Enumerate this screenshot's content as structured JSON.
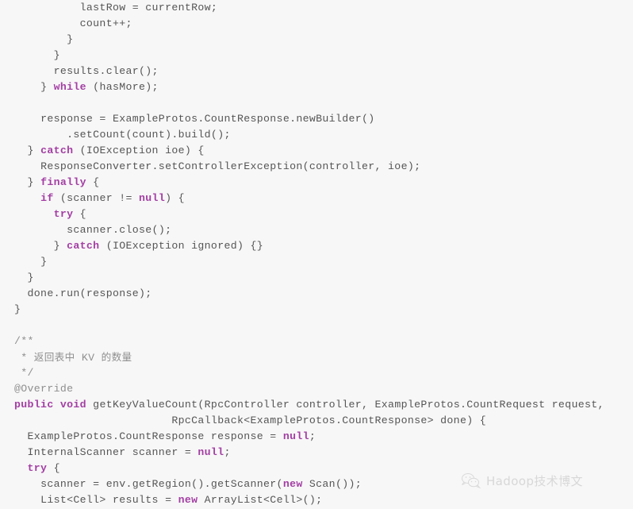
{
  "editor": {
    "language": "java",
    "background_color": "#f7f7f7",
    "default_text_color": "#555555",
    "keyword_color": "#a33ea3",
    "comment_color": "#8f8f8f",
    "lines": [
      {
        "indent": "          ",
        "segments": [
          {
            "t": "lastRow = currentRow;",
            "k": "plain"
          }
        ]
      },
      {
        "indent": "          ",
        "segments": [
          {
            "t": "count++;",
            "k": "plain"
          }
        ]
      },
      {
        "indent": "        ",
        "segments": [
          {
            "t": "}",
            "k": "plain"
          }
        ]
      },
      {
        "indent": "      ",
        "segments": [
          {
            "t": "}",
            "k": "plain"
          }
        ]
      },
      {
        "indent": "      ",
        "segments": [
          {
            "t": "results.clear();",
            "k": "plain"
          }
        ]
      },
      {
        "indent": "    ",
        "segments": [
          {
            "t": "} ",
            "k": "plain"
          },
          {
            "t": "while",
            "k": "kw"
          },
          {
            "t": " (hasMore);",
            "k": "plain"
          }
        ]
      },
      {
        "indent": "",
        "segments": []
      },
      {
        "indent": "    ",
        "segments": [
          {
            "t": "response = ExampleProtos.CountResponse.newBuilder()",
            "k": "plain"
          }
        ]
      },
      {
        "indent": "        ",
        "segments": [
          {
            "t": ".setCount(count).build();",
            "k": "plain"
          }
        ]
      },
      {
        "indent": "  ",
        "segments": [
          {
            "t": "} ",
            "k": "plain"
          },
          {
            "t": "catch",
            "k": "kw"
          },
          {
            "t": " (IOException ioe) {",
            "k": "plain"
          }
        ]
      },
      {
        "indent": "    ",
        "segments": [
          {
            "t": "ResponseConverter.setControllerException(controller, ioe);",
            "k": "plain"
          }
        ]
      },
      {
        "indent": "  ",
        "segments": [
          {
            "t": "} ",
            "k": "plain"
          },
          {
            "t": "finally",
            "k": "kw"
          },
          {
            "t": " {",
            "k": "plain"
          }
        ]
      },
      {
        "indent": "    ",
        "segments": [
          {
            "t": "if",
            "k": "kw"
          },
          {
            "t": " (scanner != ",
            "k": "plain"
          },
          {
            "t": "null",
            "k": "kw"
          },
          {
            "t": ") {",
            "k": "plain"
          }
        ]
      },
      {
        "indent": "      ",
        "segments": [
          {
            "t": "try",
            "k": "kw"
          },
          {
            "t": " {",
            "k": "plain"
          }
        ]
      },
      {
        "indent": "        ",
        "segments": [
          {
            "t": "scanner.close();",
            "k": "plain"
          }
        ]
      },
      {
        "indent": "      ",
        "segments": [
          {
            "t": "} ",
            "k": "plain"
          },
          {
            "t": "catch",
            "k": "kw"
          },
          {
            "t": " (IOException ignored) {}",
            "k": "plain"
          }
        ]
      },
      {
        "indent": "    ",
        "segments": [
          {
            "t": "}",
            "k": "plain"
          }
        ]
      },
      {
        "indent": "  ",
        "segments": [
          {
            "t": "}",
            "k": "plain"
          }
        ]
      },
      {
        "indent": "  ",
        "segments": [
          {
            "t": "done.run(response);",
            "k": "plain"
          }
        ]
      },
      {
        "indent": "",
        "segments": [
          {
            "t": "}",
            "k": "plain"
          }
        ]
      },
      {
        "indent": "",
        "segments": []
      },
      {
        "indent": "",
        "segments": [
          {
            "t": "/**",
            "k": "cmt"
          }
        ]
      },
      {
        "indent": "",
        "segments": [
          {
            "t": " * ",
            "k": "cmt"
          },
          {
            "t": "返回表中",
            "k": "cmt-cjk"
          },
          {
            "t": " KV ",
            "k": "cmt"
          },
          {
            "t": "的数量",
            "k": "cmt-cjk"
          }
        ]
      },
      {
        "indent": "",
        "segments": [
          {
            "t": " */",
            "k": "cmt"
          }
        ]
      },
      {
        "indent": "",
        "segments": [
          {
            "t": "@Override",
            "k": "cmt"
          }
        ]
      },
      {
        "indent": "",
        "segments": [
          {
            "t": "public",
            "k": "kw"
          },
          {
            "t": " ",
            "k": "plain"
          },
          {
            "t": "void",
            "k": "kw"
          },
          {
            "t": " getKeyValueCount(RpcController controller, ExampleProtos.CountRequest request,",
            "k": "plain"
          }
        ]
      },
      {
        "indent": "                        ",
        "segments": [
          {
            "t": "RpcCallback<ExampleProtos.CountResponse> done) {",
            "k": "plain"
          }
        ]
      },
      {
        "indent": "  ",
        "segments": [
          {
            "t": "ExampleProtos.CountResponse response = ",
            "k": "plain"
          },
          {
            "t": "null",
            "k": "kw"
          },
          {
            "t": ";",
            "k": "plain"
          }
        ]
      },
      {
        "indent": "  ",
        "segments": [
          {
            "t": "InternalScanner scanner = ",
            "k": "plain"
          },
          {
            "t": "null",
            "k": "kw"
          },
          {
            "t": ";",
            "k": "plain"
          }
        ]
      },
      {
        "indent": "  ",
        "segments": [
          {
            "t": "try",
            "k": "kw"
          },
          {
            "t": " {",
            "k": "plain"
          }
        ]
      },
      {
        "indent": "    ",
        "segments": [
          {
            "t": "scanner = env.getRegion().getScanner(",
            "k": "plain"
          },
          {
            "t": "new",
            "k": "kw"
          },
          {
            "t": " Scan());",
            "k": "plain"
          }
        ]
      },
      {
        "indent": "    ",
        "segments": [
          {
            "t": "List<Cell> results = ",
            "k": "plain"
          },
          {
            "t": "new",
            "k": "kw"
          },
          {
            "t": " ArrayList<Cell>();",
            "k": "plain"
          }
        ]
      }
    ]
  },
  "watermark": {
    "icon": "wechat-icon",
    "text": "Hadoop技术博文",
    "color": "#b9b9b9"
  }
}
